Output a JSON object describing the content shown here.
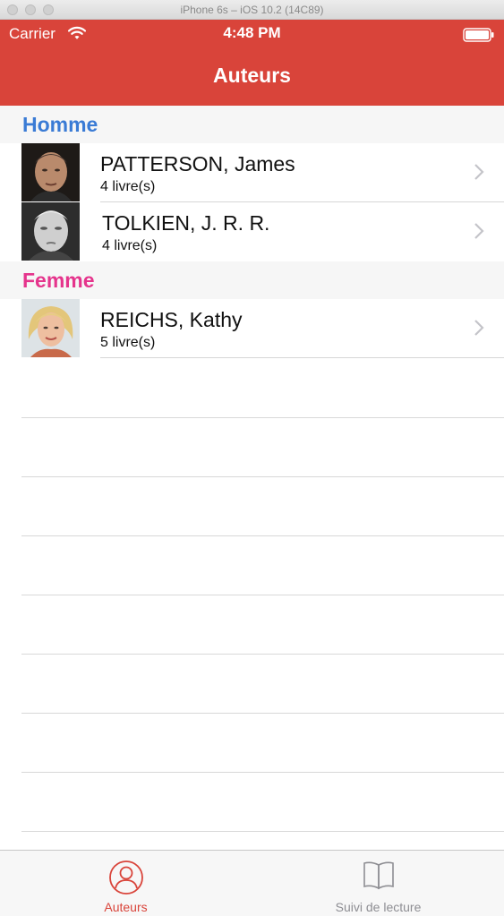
{
  "window": {
    "title": "iPhone 6s – iOS 10.2 (14C89)"
  },
  "status_bar": {
    "carrier": "Carrier",
    "time": "4:48 PM"
  },
  "nav": {
    "title": "Auteurs"
  },
  "colors": {
    "header_red": "#d9443a",
    "homme_blue": "#3a7bd5",
    "femme_pink": "#e5348c",
    "tab_active": "#d9443a",
    "tab_inactive": "#8e8e93"
  },
  "sections": [
    {
      "title": "Homme",
      "authors": [
        {
          "name": "PATTERSON, James",
          "count": "4 livre(s)"
        },
        {
          "name": "TOLKIEN, J. R. R.",
          "count": "4 livre(s)"
        }
      ]
    },
    {
      "title": "Femme",
      "authors": [
        {
          "name": "REICHS, Kathy",
          "count": "5 livre(s)"
        }
      ]
    }
  ],
  "tabs": [
    {
      "label": "Auteurs",
      "icon": "person-circle-icon",
      "active": true
    },
    {
      "label": "Suivi de lecture",
      "icon": "open-book-icon",
      "active": false
    }
  ]
}
